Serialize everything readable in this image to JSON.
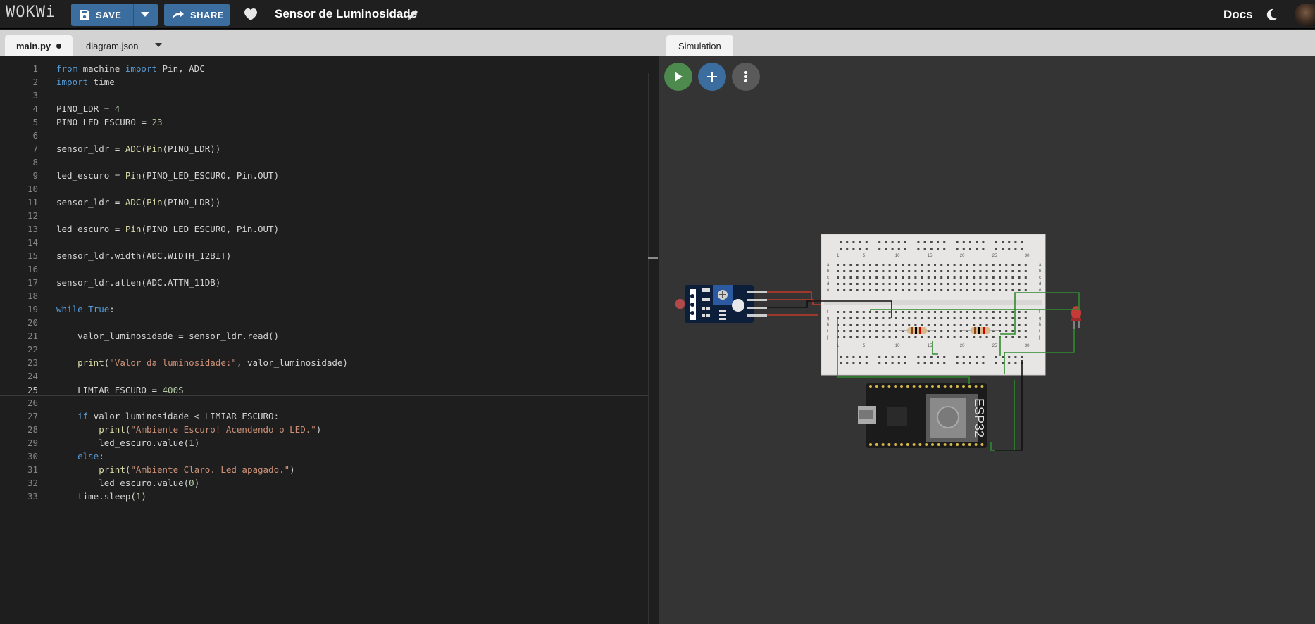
{
  "app": {
    "logo": "WOKWi"
  },
  "toolbar": {
    "save_label": "SAVE",
    "share_label": "SHARE",
    "project_title": "Sensor de Luminosidade",
    "docs_label": "Docs"
  },
  "editor": {
    "tabs": [
      {
        "label": "main.py",
        "modified": true,
        "active": true
      },
      {
        "label": "diagram.json",
        "modified": false,
        "active": false
      }
    ],
    "active_line": 25,
    "lines": [
      [
        [
          "kw",
          "from"
        ],
        [
          "pl",
          " machine "
        ],
        [
          "kw",
          "import"
        ],
        [
          "pl",
          " Pin, ADC"
        ]
      ],
      [
        [
          "kw",
          "import"
        ],
        [
          "pl",
          " time"
        ]
      ],
      [],
      [
        [
          "pl",
          "PINO_LDR = "
        ],
        [
          "num",
          "4"
        ]
      ],
      [
        [
          "pl",
          "PINO_LED_ESCURO = "
        ],
        [
          "num",
          "23"
        ]
      ],
      [],
      [
        [
          "pl",
          "sensor_ldr = "
        ],
        [
          "fn",
          "ADC"
        ],
        [
          "pl",
          "("
        ],
        [
          "fn",
          "Pin"
        ],
        [
          "pl",
          "(PINO_LDR))"
        ]
      ],
      [],
      [
        [
          "pl",
          "led_escuro = "
        ],
        [
          "fn",
          "Pin"
        ],
        [
          "pl",
          "(PINO_LED_ESCURO, Pin.OUT)"
        ]
      ],
      [],
      [
        [
          "pl",
          "sensor_ldr = "
        ],
        [
          "fn",
          "ADC"
        ],
        [
          "pl",
          "("
        ],
        [
          "fn",
          "Pin"
        ],
        [
          "pl",
          "(PINO_LDR))"
        ]
      ],
      [],
      [
        [
          "pl",
          "led_escuro = "
        ],
        [
          "fn",
          "Pin"
        ],
        [
          "pl",
          "(PINO_LED_ESCURO, Pin.OUT)"
        ]
      ],
      [],
      [
        [
          "pl",
          "sensor_ldr.width(ADC.WIDTH_12BIT)"
        ]
      ],
      [],
      [
        [
          "pl",
          "sensor_ldr.atten(ADC.ATTN_11DB)"
        ]
      ],
      [],
      [
        [
          "kw",
          "while"
        ],
        [
          "pl",
          " "
        ],
        [
          "kw",
          "True"
        ],
        [
          "pl",
          ":"
        ]
      ],
      [],
      [
        [
          "pl",
          "    valor_luminosidade = sensor_ldr.read()"
        ]
      ],
      [],
      [
        [
          "pl",
          "    "
        ],
        [
          "fn",
          "print"
        ],
        [
          "pl",
          "("
        ],
        [
          "str",
          "\"Valor da luminosidade:\""
        ],
        [
          "pl",
          ", valor_luminosidade)"
        ]
      ],
      [],
      [
        [
          "pl",
          "    LIMIAR_ESCURO = "
        ],
        [
          "num",
          "400S"
        ]
      ],
      [],
      [
        [
          "pl",
          "    "
        ],
        [
          "kw",
          "if"
        ],
        [
          "pl",
          " valor_luminosidade < LIMIAR_ESCURO:"
        ]
      ],
      [
        [
          "pl",
          "        "
        ],
        [
          "fn",
          "print"
        ],
        [
          "pl",
          "("
        ],
        [
          "str",
          "\"Ambiente Escuro! Acendendo o LED.\""
        ],
        [
          "pl",
          ")"
        ]
      ],
      [
        [
          "pl",
          "        led_escuro.value("
        ],
        [
          "num",
          "1"
        ],
        [
          "pl",
          ")"
        ]
      ],
      [
        [
          "pl",
          "    "
        ],
        [
          "kw",
          "else"
        ],
        [
          "pl",
          ":"
        ]
      ],
      [
        [
          "pl",
          "        "
        ],
        [
          "fn",
          "print"
        ],
        [
          "pl",
          "("
        ],
        [
          "str",
          "\"Ambiente Claro. Led apagado.\""
        ],
        [
          "pl",
          ")"
        ]
      ],
      [
        [
          "pl",
          "        led_escuro.value("
        ],
        [
          "num",
          "0"
        ],
        [
          "pl",
          ")"
        ]
      ],
      [
        [
          "pl",
          "    time.sleep("
        ],
        [
          "num",
          "1"
        ],
        [
          "pl",
          ")"
        ]
      ]
    ]
  },
  "simulation": {
    "tab_label": "Simulation",
    "breadboard_col_labels": [
      "1",
      "5",
      "10",
      "15",
      "20",
      "25",
      "30"
    ],
    "breadboard_row_labels": [
      "a",
      "b",
      "c",
      "d",
      "e",
      "f",
      "g",
      "h",
      "i",
      "j"
    ],
    "esp32_label": "ESP32"
  },
  "colors": {
    "accent": "#3b6e9e",
    "play": "#4d8a4d",
    "sim_background": "#343434",
    "editor_background": "#1e1e1e"
  }
}
